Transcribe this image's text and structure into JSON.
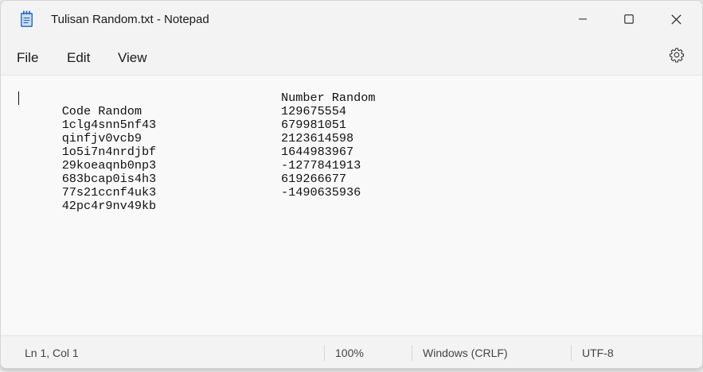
{
  "window": {
    "title": "Tulisan Random.txt - Notepad"
  },
  "menu": {
    "file": "File",
    "edit": "Edit",
    "view": "View"
  },
  "icons": {
    "app": "notepad-icon",
    "minimize": "minimize-icon",
    "maximize": "maximize-icon",
    "close": "close-icon",
    "settings": "gear-icon"
  },
  "editor": {
    "lines": [
      {
        "code": "Code Random",
        "number": "Number Random"
      },
      {
        "code": "1clg4snn5nf43",
        "number": "129675554"
      },
      {
        "code": "qinfjv0vcb9",
        "number": "679981051"
      },
      {
        "code": "1o5i7n4nrdjbf",
        "number": "2123614598"
      },
      {
        "code": "29koeaqnb0np3",
        "number": "1644983967"
      },
      {
        "code": "683bcap0is4h3",
        "number": "-1277841913"
      },
      {
        "code": "77s21ccnf4uk3",
        "number": "619266677"
      },
      {
        "code": "42pc4r9nv49kb",
        "number": "-1490635936"
      }
    ]
  },
  "status": {
    "position": "Ln 1, Col 1",
    "zoom": "100%",
    "line_ending": "Windows (CRLF)",
    "encoding": "UTF-8"
  },
  "colors": {
    "chrome": "#f3f3f3",
    "editor_bg": "#f9f9f9",
    "text": "#1a1a1a",
    "icon_blue": "#3a76c4"
  }
}
